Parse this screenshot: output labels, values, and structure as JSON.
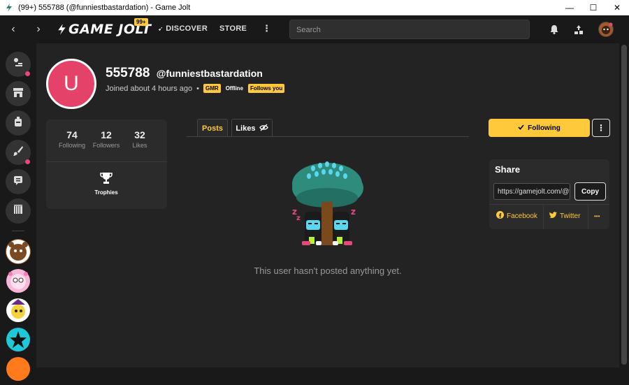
{
  "window": {
    "title": "(99+) 555788 (@funniestbastardation) - Game Jolt",
    "minimize": "—",
    "maximize": "☐",
    "close": "✕"
  },
  "nav": {
    "back": "‹",
    "forward": "›",
    "logo": "GAME JOLT",
    "notif_badge": "99+",
    "discover": "DISCOVER",
    "store": "STORE",
    "more": "⋮",
    "search_placeholder": "Search"
  },
  "profile": {
    "avatar_letter": "U",
    "display_name": "555788",
    "username": "@funniestbastardation",
    "joined": "Joined about 4 hours ago",
    "badge_gmr": "GMR",
    "status": "Offline",
    "follows_you": "Follows you"
  },
  "stats": {
    "following": {
      "value": "74",
      "label": "Following"
    },
    "followers": {
      "value": "12",
      "label": "Followers"
    },
    "likes": {
      "value": "32",
      "label": "Likes"
    },
    "trophies_label": "Trophies"
  },
  "tabs": [
    {
      "label": "Posts",
      "active": true
    },
    {
      "label": "Likes",
      "active": false
    }
  ],
  "empty_message": "This user hasn't posted anything yet.",
  "actions": {
    "following_label": "Following",
    "more": "⋮"
  },
  "share": {
    "title": "Share",
    "url": "https://gamejolt.com/@funniestbastardation",
    "copy": "Copy",
    "facebook": "Facebook",
    "twitter": "Twitter",
    "more": "•••"
  },
  "colors": {
    "accent": "#ffc93c",
    "avatar": "#e5426a",
    "notification": "#e6487a"
  }
}
